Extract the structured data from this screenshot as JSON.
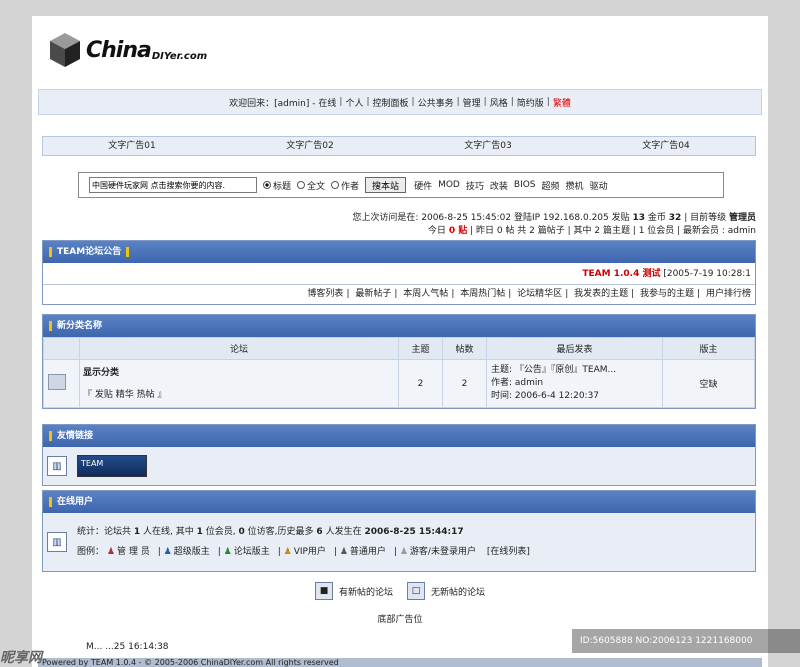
{
  "logo": {
    "main": "China",
    "sub": "DIYer.com"
  },
  "welcome": {
    "prefix": "欢迎回来：[admin] -",
    "items": [
      "在线",
      "个人",
      "控制面板",
      "公共事务",
      "管理",
      "风格",
      "简约版"
    ],
    "warn": "繁體"
  },
  "ads": [
    "文字广告01",
    "文字广告02",
    "文字广告03",
    "文字广告04"
  ],
  "search": {
    "value": "中国硬件玩家网 点击搜索你要的内容.",
    "options": [
      "标题",
      "全文",
      "作者"
    ],
    "button": "搜本站",
    "keywords": [
      "硬件",
      "MOD",
      "技巧",
      "改装",
      "BIOS",
      "超频",
      "攒机",
      "驱动"
    ]
  },
  "visit": {
    "line1_a": "您上次访问是在: 2006-8-25 15:45:02 登陆IP 192.168.0.205 发贴",
    "posts": "13",
    "line1_b": "金币",
    "coins": "32",
    "line1_c": "| 目前等级",
    "level": "管理员",
    "line2_a": "今日",
    "today": "0 贴",
    "line2_b": "| 昨日 0 帖 共 2 篇帖子 | 其中 2 篇主题 | 1 位会员 | 最新会员 : admin"
  },
  "notice": {
    "title": "TEAM论坛公告",
    "headline": "TEAM 1.0.4 测试",
    "date": "[2005-7-19 10:28:1",
    "links": [
      "博客列表",
      "最新帖子",
      "本周人气帖",
      "本周热门帖",
      "论坛精华区",
      "我发表的主题",
      "我参与的主题",
      "用户排行榜"
    ]
  },
  "category": {
    "title": "新分类名称",
    "headers": [
      "论坛",
      "主题",
      "帖数",
      "最后发表",
      "版主"
    ],
    "forum": {
      "name": "显示分类",
      "sub": "『 发贴 精华 热帖 』",
      "topics": "2",
      "posts": "2",
      "last_subject": "主题: 『公告』『原创』TEAM...",
      "last_author": "作者: admin",
      "last_time": "时间: 2006-6-4 12:20:37",
      "moderator": "空缺"
    }
  },
  "friends": {
    "title": "友情链接",
    "link": "TEAM"
  },
  "online": {
    "title": "在线用户",
    "stat_a": "统计：论坛共",
    "stat_online": "1",
    "stat_b": "人在线, 其中",
    "stat_members": "1",
    "stat_c": "位会员,",
    "stat_guests": "0",
    "stat_d": "位访客,历史最多",
    "stat_max": "6",
    "stat_e": "人发生在",
    "stat_time": "2006-8-25 15:44:17",
    "legend_label": "图例：",
    "legend": [
      "管 理 员",
      "超级版主",
      "论坛版主",
      "VIP用户",
      "普通用户",
      "游客/未登录用户"
    ],
    "list_link": "[在线列表]"
  },
  "status": {
    "new": "有新帖的论坛",
    "none": "无新帖的论坛"
  },
  "bottom_ad": "底部广告位",
  "footer": {
    "time": "M... ...25 16:14:38",
    "bar": "Powered by TEAM 1.0.4 - © 2005-2006 ChinaDIYer.com All rights reserved"
  },
  "watermark": {
    "left": "昵享网",
    "id": "ID:5605888 NO:2006123 1221168000"
  }
}
